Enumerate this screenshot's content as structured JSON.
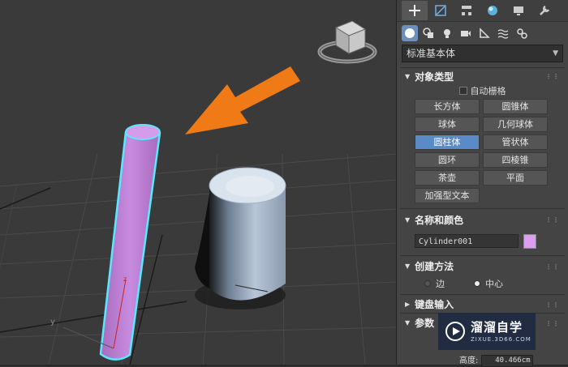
{
  "tabs": [
    "create-icon",
    "modify-icon",
    "hierarchy-icon",
    "motion-icon",
    "display-icon",
    "utilities-icon"
  ],
  "categories": [
    "geometry-icon",
    "shapes-icon",
    "lights-icon",
    "cameras-icon",
    "helpers-icon",
    "space-warps-icon",
    "systems-icon"
  ],
  "dropdown": {
    "value": "标准基本体"
  },
  "object_type": {
    "title": "对象类型",
    "autogrid_label": "自动栅格",
    "buttons": [
      "长方体",
      "圆锥体",
      "球体",
      "几何球体",
      "圆柱体",
      "管状体",
      "圆环",
      "四棱锥",
      "茶壶",
      "平面",
      "加强型文本"
    ],
    "selected": "圆柱体"
  },
  "name_color": {
    "title": "名称和颜色",
    "name_value": "Cylinder001",
    "color": "#dd9ef0"
  },
  "creation_method": {
    "title": "创建方法",
    "edge": "边",
    "center": "中心",
    "selected": "中心"
  },
  "keyboard_entry": {
    "title": "键盘输入"
  },
  "parameters": {
    "title": "参数",
    "height_label": "高度:",
    "height_value": "40.466cm"
  },
  "watermark": {
    "title": "溜溜自学",
    "subtitle": "ZIXUE.3D66.COM"
  },
  "viewport": {
    "axis_x": "y",
    "axis_z": "z"
  }
}
